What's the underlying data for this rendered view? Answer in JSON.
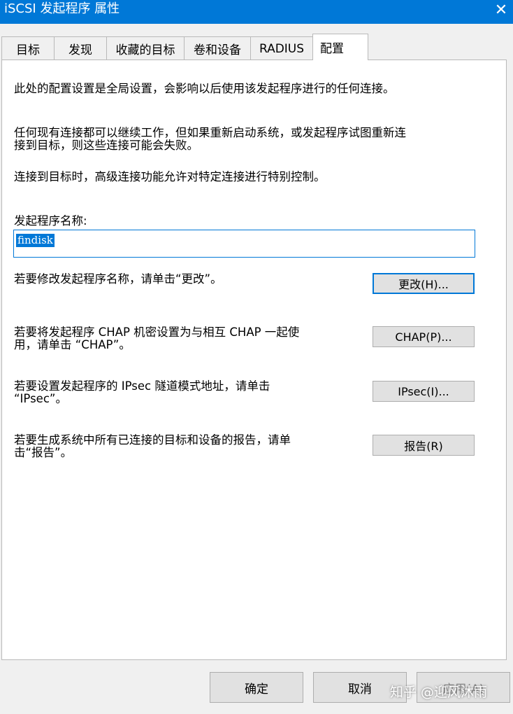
{
  "window": {
    "title": "iSCSI 发起程序 属性",
    "close_glyph": "✕"
  },
  "tabs": [
    {
      "label": "目标"
    },
    {
      "label": "发现"
    },
    {
      "label": "收藏的目标"
    },
    {
      "label": "卷和设备"
    },
    {
      "label": "RADIUS"
    },
    {
      "label": "配置"
    }
  ],
  "config": {
    "intro": "此处的配置设置是全局设置，会影响以后使用该发起程序进行的任何连接。",
    "existing_line1": "任何现有连接都可以继续工作，但如果重新启动系统，或发起程序试图重新连",
    "existing_line2": "接到目标，则这些连接可能会失败。",
    "advanced": "连接到目标时，高级连接功能允许对特定连接进行特别控制。",
    "name_label": "发起程序名称:",
    "name_value": "findisk",
    "change_text": "若要修改发起程序名称，请单击“更改”。",
    "change_button": "更改(H)...",
    "chap_line1": "若要将发起程序 CHAP 机密设置为与相互 CHAP 一起使",
    "chap_line2": "用，请单击 “CHAP”。",
    "chap_button": "CHAP(P)...",
    "ipsec_line1": "若要设置发起程序的 IPsec 隧道模式地址，请单击",
    "ipsec_line2": "“IPsec”。",
    "ipsec_button": "IPsec(I)...",
    "report_line1": "若要生成系统中所有已连接的目标和设备的报告，请单",
    "report_line2": "击“报告”。",
    "report_button": "报告(R)"
  },
  "footer": {
    "ok": "确定",
    "cancel": "取消",
    "apply": "应用(A)"
  },
  "watermark": "知乎 @迎风沐雨",
  "colors": {
    "title_bar": "#0078d7",
    "focus": "#0078d7",
    "dialog_bg": "#f0f0f0",
    "button_bg": "#e1e1e1"
  }
}
